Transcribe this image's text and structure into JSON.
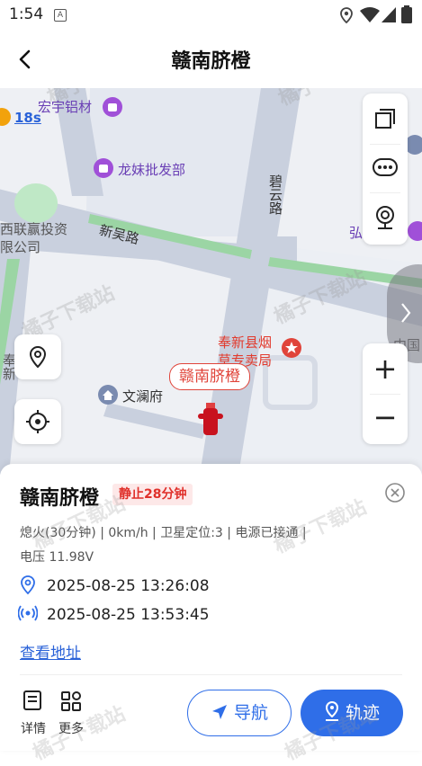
{
  "status_bar": {
    "time": "1:54",
    "notif_letter": "A"
  },
  "header": {
    "title": "赣南脐橙",
    "back_icon": "chevron-left-icon"
  },
  "map": {
    "pois": {
      "hongyu": "宏宇铝材",
      "longmei": "龙妹批发部",
      "wenlan": "文澜府",
      "tobacco_line1": "奉新县烟",
      "tobacco_line2": "草专卖局",
      "hong": "弘",
      "zhongguo": "中国",
      "lianying_line1": "西联赢投资",
      "lianying_line2": "限公司",
      "left_vertical": "奉新"
    },
    "roads": {
      "xinwu": "新吴路",
      "biyun": "碧云路"
    },
    "bus_time": "18s",
    "vehicle_label": "赣南脐橙",
    "watermark": "橘子下载站"
  },
  "map_tools": [
    "layers-icon",
    "more-icon",
    "street-view-icon"
  ],
  "zoom": {
    "in": "+",
    "out": "−"
  },
  "card": {
    "name": "赣南脐橙",
    "status_badge": "静止28分钟",
    "info_line1": "熄火(30分钟) | 0km/h | 卫星定位:3 | 电源已接通 |",
    "info_line2": "电压 11.98V",
    "location_time": "2025-08-25 13:26:08",
    "signal_time": "2025-08-25 13:53:45",
    "view_address": "查看地址",
    "details": "详情",
    "more": "更多",
    "navigate": "导航",
    "track": "轨迹"
  },
  "colors": {
    "accent": "#2f6ee8",
    "alert": "#e0302a",
    "poi": "#a050d8"
  }
}
